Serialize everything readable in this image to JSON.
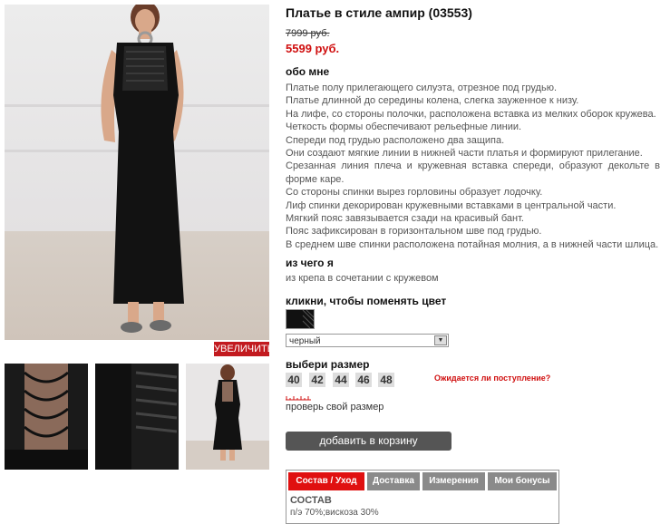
{
  "product": {
    "title": "Платье в стиле ампир (03553)",
    "old_price": "7999 руб.",
    "new_price": "5599 руб."
  },
  "gallery": {
    "zoom_label": "УВЕЛИЧИТЬ"
  },
  "about": {
    "heading": "обо мне",
    "lines": [
      "Платье полу прилегающего силуэта, отрезное под грудью.",
      "Платье длинной до середины колена, слегка зауженное к низу.",
      "На лифе, со стороны полочки, расположена вставка из мелких оборок кружева.",
      "Четкость формы обеспечивают рельефные линии.",
      "Спереди под грудью расположено два защипа.",
      "Они создают мягкие линии в нижней части платья и формируют прилегание.",
      "Срезанная линия плеча и кружевная вставка спереди, образуют декольте в форме каре.",
      "Со стороны спинки вырез горловины образует лодочку.",
      "Лиф спинки декорирован кружевными вставками в центральной части.",
      "Мягкий пояс завязывается сзади на красивый бант.",
      "Пояс зафиксирован в горизонтальном шве под грудью.",
      "В среднем шве спинки расположена потайная молния, а в нижней части шлица."
    ]
  },
  "material": {
    "heading": "из чего я",
    "text": "из крепа в сочетании с кружевом"
  },
  "color": {
    "heading": "кликни, чтобы поменять цвет",
    "selected": "черный",
    "swatch_color": "#111111"
  },
  "size": {
    "heading": "выбери размер",
    "options": [
      "40",
      "42",
      "44",
      "46",
      "48"
    ],
    "notify_label": "Ожидается ли поступление?",
    "check_label": "проверь свой размер"
  },
  "cart": {
    "add_label": "добавить в корзину"
  },
  "tabs": {
    "items": [
      "Состав / Уход",
      "Доставка",
      "Измерения",
      "Мои бонусы"
    ],
    "active_index": 0
  },
  "composition": {
    "heading": "СОСТАВ",
    "text": "п/э 70%;вискоза 30%"
  },
  "colors": {
    "accent_red": "#e01010",
    "price_red": "#d01010",
    "button_gray": "#555555",
    "tab_gray": "#8a8a8a"
  }
}
